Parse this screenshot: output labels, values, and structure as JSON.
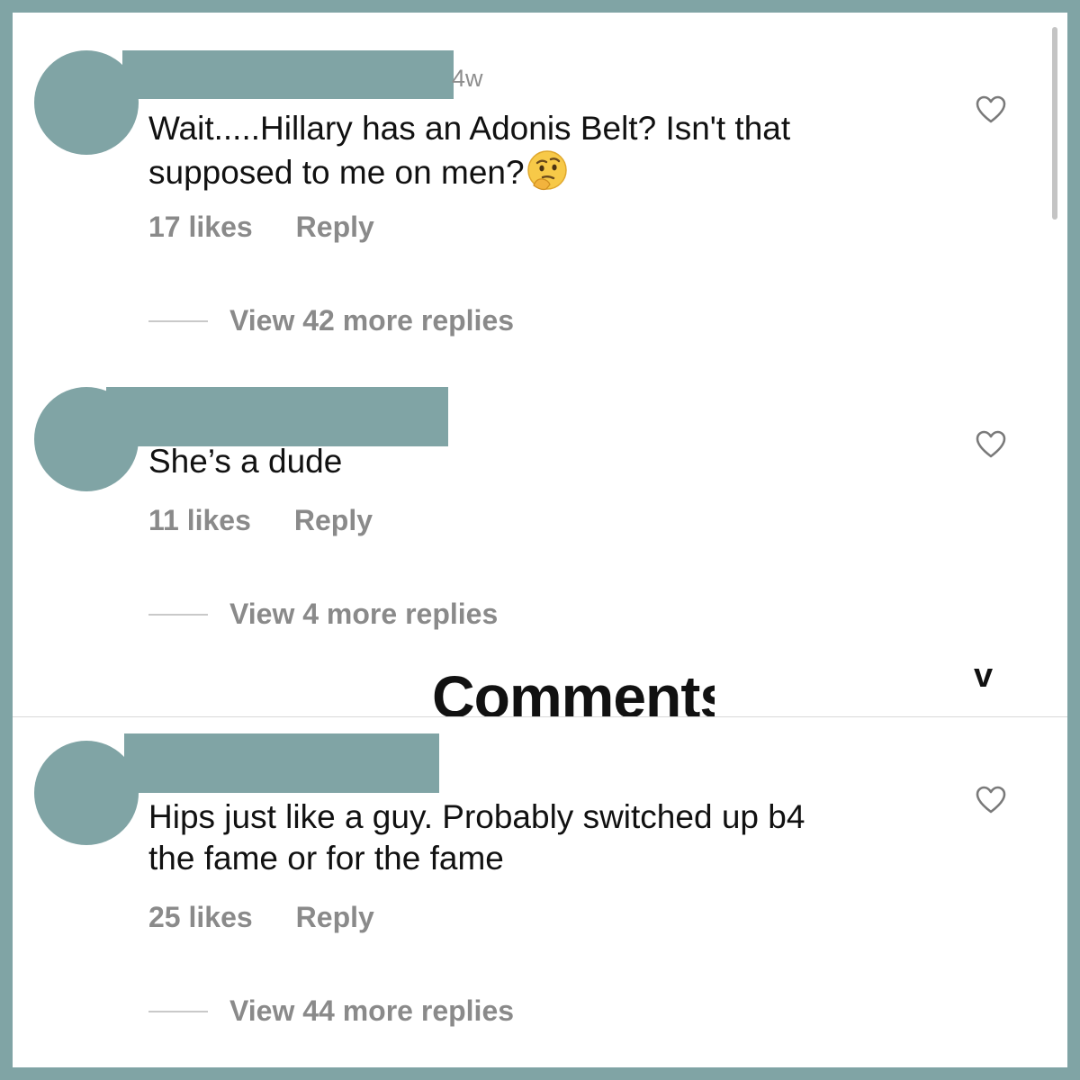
{
  "comments": [
    {
      "timestamp": "4w",
      "text": "Wait.....Hillary has an Adonis Belt? Isn't that\nsupposed to me on men?",
      "emoji": "thinking-face",
      "likes": "17 likes",
      "reply_label": "Reply",
      "view_replies": "View 42 more replies"
    },
    {
      "text": "She’s a dude",
      "likes": "11 likes",
      "reply_label": "Reply",
      "view_replies": "View 4 more replies"
    },
    {
      "text": "Hips just like a guy. Probably switched up b4\nthe fame or for the fame",
      "likes": "25 likes",
      "reply_label": "Reply",
      "view_replies": "View 44 more replies"
    }
  ],
  "sheet_header": {
    "title": "Comments",
    "close_icon": "chevron-down-icon"
  },
  "colors": {
    "frame": "#80a4a5",
    "redaction": "#80a4a5",
    "secondary_text": "#8a8a8a",
    "primary_text": "#111111"
  }
}
